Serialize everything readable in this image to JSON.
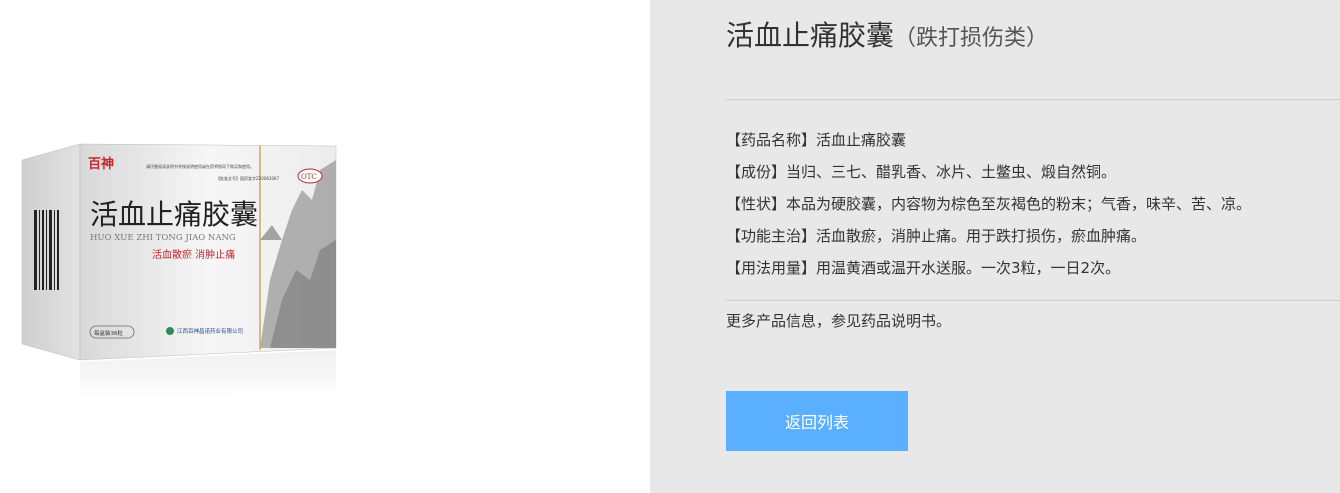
{
  "product": {
    "title": "活血止痛胶囊",
    "subtitle": "（跌打损伤类）",
    "info_lines": [
      "【药品名称】活血止痛胶囊",
      "【成份】当归、三七、醋乳香、冰片、土鳖虫、煅自然铜。",
      "【性状】本品为硬胶囊，内容物为棕色至灰褐色的粉末；气香，味辛、苦、凉。",
      "【功能主治】活血散瘀，消肿止痛。用于跌打损伤，瘀血肿痛。",
      "【用法用量】用温黄酒或温开水送服。一次3粒，一日2次。"
    ],
    "more_info": "更多产品信息，参见药品说明书。",
    "back_button": "返回列表"
  },
  "box": {
    "brand": "百神",
    "name_cn": "活血止痛胶囊",
    "name_pinyin": "HUO XUE ZHI TONG JIAO NANG",
    "slogan": "活血散瘀  消肿止痛",
    "otc": "OTC",
    "notice": "请仔细阅读说明书并按说明使用或在药师指导下购买和使用。",
    "approval": "【批准文号】国药准字Z20063067",
    "count": "每盒装36粒",
    "maker": "江西百神昌诺药业有限公司"
  },
  "colors": {
    "panel_bg": "#e8e8e8",
    "button_bg": "#5ab0ff",
    "brand_red": "#c0282d"
  }
}
